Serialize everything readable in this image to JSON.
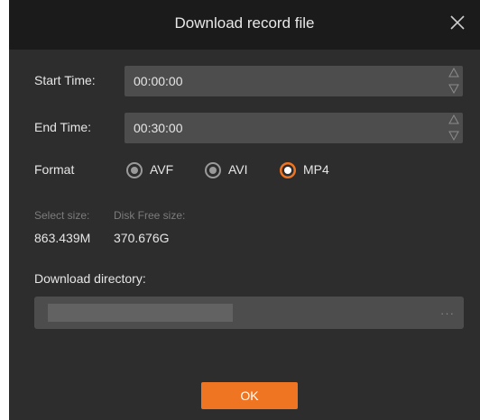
{
  "dialog": {
    "title": "Download record file",
    "close_icon": "close-icon"
  },
  "start_time": {
    "label": "Start Time:",
    "value": "00:00:00"
  },
  "end_time": {
    "label": "End Time:",
    "value": "00:30:00"
  },
  "format": {
    "label": "Format",
    "options": [
      "AVF",
      "AVI",
      "MP4"
    ],
    "selected": "MP4"
  },
  "size": {
    "select_label": "Select size:",
    "select_value": "863.439M",
    "free_label": "Disk Free size:",
    "free_value": "370.676G"
  },
  "download_directory": {
    "label": "Download directory:",
    "browse_label": "···"
  },
  "ok_button": {
    "label": "OK"
  },
  "colors": {
    "accent": "#f07522",
    "background": "#2d2d2d",
    "titlebar": "#1b1b1b",
    "field": "#4d4d4d"
  }
}
